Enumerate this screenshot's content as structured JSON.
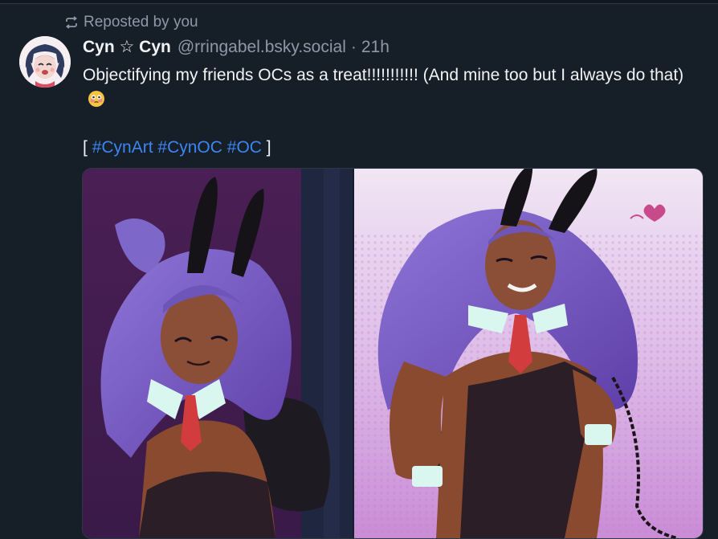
{
  "repost_label": "Reposted by you",
  "post": {
    "display_name": "Cyn ☆ Cyn",
    "handle": "@rringabel.bsky.social",
    "separator": "·",
    "time": "21h",
    "text": "Objectifying my friends OCs as a treat!!!!!!!!!!! (And mine too but I always do that)",
    "tags_open": "[",
    "tags_close": "]",
    "tags": [
      "#CynArt",
      "#CynOC",
      "#OC"
    ]
  },
  "icons": {
    "repost": "repost-icon",
    "emoji": "flushed-face-icon"
  },
  "colors": {
    "background": "#161e27",
    "link": "#3b86f2",
    "muted": "#8d99a9"
  }
}
